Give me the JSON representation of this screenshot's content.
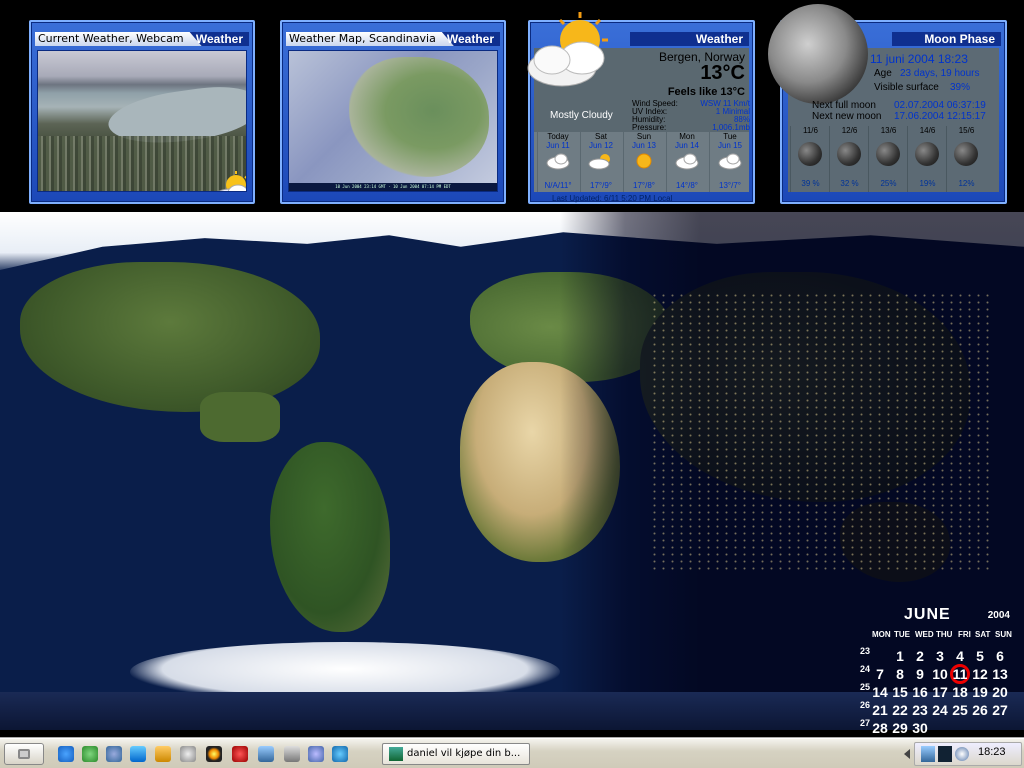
{
  "widgets": {
    "webcam": {
      "title": "Current Weather, Webcam",
      "tag": "Weather"
    },
    "map": {
      "title": "Weather Map, Scandinavia",
      "tag": "Weather",
      "caption": "10 Jun 2004 23:14 GMT · 10 Jun 2004 07:14 PM EDT"
    },
    "current": {
      "tag": "Weather",
      "location": "Bergen, Norway",
      "temp": "13°C",
      "feels": "Feels like 13°C",
      "condition": "Mostly Cloudy",
      "rows": [
        {
          "label": "Wind Speed:",
          "value": "WSW 11 Km/t"
        },
        {
          "label": "UV Index:",
          "value": "1 Minimal"
        },
        {
          "label": "Humidity:",
          "value": "88%"
        },
        {
          "label": "Pressure:",
          "value": "1,006.1mb"
        }
      ],
      "forecast": [
        {
          "day": "Today",
          "date": "Jun 11",
          "temp": "N/A/11°",
          "icon": "cloud-icon"
        },
        {
          "day": "Sat",
          "date": "Jun 12",
          "temp": "17°/9°",
          "icon": "partly-cloudy-icon"
        },
        {
          "day": "Sun",
          "date": "Jun 13",
          "temp": "17°/8°",
          "icon": "sun-icon"
        },
        {
          "day": "Mon",
          "date": "Jun 14",
          "temp": "14°/8°",
          "icon": "cloud-icon"
        },
        {
          "day": "Tue",
          "date": "Jun 15",
          "temp": "13°/7°",
          "icon": "cloud-icon"
        }
      ],
      "updated": "Last Updated: 6/11 5:20 PM Local"
    },
    "moon": {
      "tag": "Moon Phase",
      "date": "11 juni 2004  18:23",
      "age_label": "Age",
      "age": "23 days, 19 hours",
      "vis_label": "Visible surface",
      "vis": "39%",
      "full_label": "Next full moon",
      "full": "02.07.2004 06:37:19",
      "new_label": "Next new moon",
      "new": "17.06.2004 12:15:17",
      "days": [
        {
          "d": "11/6",
          "p": "39 %"
        },
        {
          "d": "12/6",
          "p": "32 %"
        },
        {
          "d": "13/6",
          "p": "25%"
        },
        {
          "d": "14/6",
          "p": "19%"
        },
        {
          "d": "15/6",
          "p": "12%"
        }
      ]
    }
  },
  "calendar": {
    "month": "JUNE",
    "year": "2004",
    "headers": [
      "MON",
      "TUE",
      "WED",
      "THU",
      "FRI",
      "SAT",
      "SUN"
    ],
    "weeks": [
      "23",
      "24",
      "25",
      "26",
      "27"
    ],
    "rows": [
      [
        "",
        "1",
        "2",
        "3",
        "4",
        "5",
        "6"
      ],
      [
        "7",
        "8",
        "9",
        "10",
        "11",
        "12",
        "13"
      ],
      [
        "14",
        "15",
        "16",
        "17",
        "18",
        "19",
        "20"
      ],
      [
        "21",
        "22",
        "23",
        "24",
        "25",
        "26",
        "27"
      ],
      [
        "28",
        "29",
        "30",
        "",
        "",
        "",
        ""
      ]
    ],
    "today": "11"
  },
  "taskbar": {
    "task": "daniel vil kjøpe din b...",
    "clock": "18:23"
  },
  "colors": {
    "widget_blue": "#2a5ccc",
    "calendar_today": "#e00000"
  }
}
